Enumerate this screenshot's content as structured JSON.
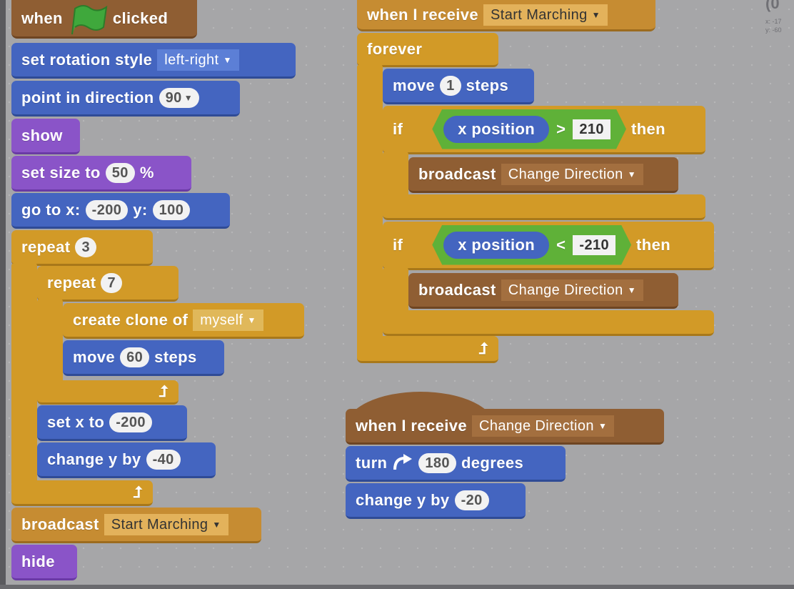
{
  "colors": {
    "motion": "#4465c0",
    "looks": "#8a54c8",
    "control": "#d29a27",
    "event": "#c68c32",
    "event_dark": "#8f5e33",
    "operator": "#5fb138",
    "canvas": "#a6a6a8"
  },
  "corner": {
    "glyph": "(0",
    "x_label": "x: -17",
    "y_label": "y: -60"
  },
  "script1": {
    "hat": {
      "when": "when",
      "clicked": "clicked",
      "icon": "green-flag-icon"
    },
    "rotation": {
      "label": "set rotation style",
      "value": "left-right"
    },
    "point": {
      "label": "point in direction",
      "value": "90"
    },
    "show": "show",
    "set_size": {
      "label": "set size to",
      "value": "50",
      "unit": "%"
    },
    "go_to": {
      "label": "go to x:",
      "x": "-200",
      "y_label": "y:",
      "y": "100"
    },
    "repeat_outer": {
      "label": "repeat",
      "value": "3"
    },
    "repeat_inner": {
      "label": "repeat",
      "value": "7"
    },
    "clone": {
      "label": "create clone of",
      "value": "myself"
    },
    "move": {
      "label": "move",
      "value": "60",
      "unit": "steps"
    },
    "set_x": {
      "label": "set x to",
      "value": "-200"
    },
    "change_y": {
      "label": "change y by",
      "value": "-40"
    },
    "broadcast": {
      "label": "broadcast",
      "value": "Start Marching"
    },
    "hide": "hide"
  },
  "script2": {
    "hat": {
      "label": "when I receive",
      "value": "Start Marching"
    },
    "forever": "forever",
    "move": {
      "label": "move",
      "value": "1",
      "unit": "steps"
    },
    "if1": {
      "if": "if",
      "reporter": "x position",
      "op": ">",
      "value": "210",
      "then": "then"
    },
    "broadcast1": {
      "label": "broadcast",
      "value": "Change Direction"
    },
    "if2": {
      "if": "if",
      "reporter": "x position",
      "op": "<",
      "value": "-210",
      "then": "then"
    },
    "broadcast2": {
      "label": "broadcast",
      "value": "Change Direction"
    }
  },
  "script3": {
    "hat": {
      "label": "when I receive",
      "value": "Change Direction"
    },
    "turn": {
      "label": "turn",
      "value": "180",
      "unit": "degrees"
    },
    "change_y": {
      "label": "change y by",
      "value": "-20"
    }
  }
}
